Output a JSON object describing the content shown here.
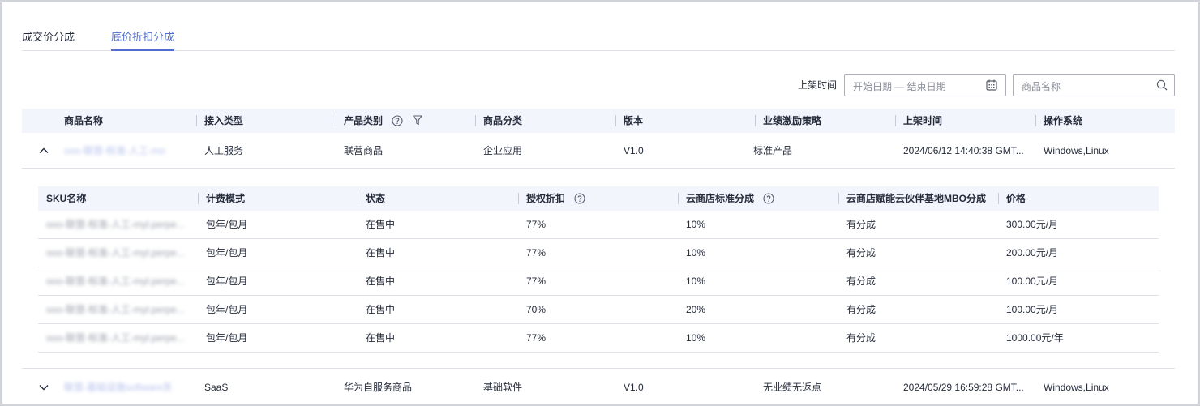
{
  "tabs": [
    {
      "label": "成交价分成",
      "active": false
    },
    {
      "label": "底价折扣分成",
      "active": true
    }
  ],
  "filters": {
    "listing_time_label": "上架时间",
    "date_placeholder": "开始日期 — 结束日期",
    "name_placeholder": "商品名称"
  },
  "main_table": {
    "headers": [
      "商品名称",
      "接入类型",
      "产品类别",
      "商品分类",
      "版本",
      "业绩激励策略",
      "上架时间",
      "操作系统"
    ],
    "rows": [
      {
        "name": "ooo-联营-标准-人工-mo",
        "access_type": "人工服务",
        "product_category": "联营商品",
        "classification": "企业应用",
        "version": "V1.0",
        "strategy": "标准产品",
        "listing_time": "2024/06/12 14:40:38 GMT...",
        "os": "Windows,Linux",
        "expanded": true
      },
      {
        "name": "联营-基础设施software测试",
        "access_type": "SaaS",
        "product_category": "华为自服务商品",
        "classification": "基础软件",
        "version": "V1.0",
        "strategy": "无业绩无返点",
        "listing_time": "2024/05/29 16:59:28 GMT...",
        "os": "Windows,Linux",
        "expanded": false
      }
    ]
  },
  "sku_table": {
    "headers": [
      "SKU名称",
      "计费模式",
      "状态",
      "授权折扣",
      "云商店标准分成",
      "云商店赋能云伙伴基地MBO分成",
      "价格"
    ],
    "rows": [
      {
        "name": "ooo-联营-标准-人工-myl.perpe...",
        "billing": "包年/包月",
        "status": "在售中",
        "discount": "77%",
        "standard_share": "10%",
        "mbo_share": "有分成",
        "price": "300.00元/月"
      },
      {
        "name": "ooo-联营-标准-人工-myl.perpe...",
        "billing": "包年/包月",
        "status": "在售中",
        "discount": "77%",
        "standard_share": "10%",
        "mbo_share": "有分成",
        "price": "200.00元/月"
      },
      {
        "name": "ooo-联营-标准-人工-myl.perpe...",
        "billing": "包年/包月",
        "status": "在售中",
        "discount": "77%",
        "standard_share": "10%",
        "mbo_share": "有分成",
        "price": "100.00元/月"
      },
      {
        "name": "ooo-联营-标准-人工-myl.perpe...",
        "billing": "包年/包月",
        "status": "在售中",
        "discount": "70%",
        "standard_share": "20%",
        "mbo_share": "有分成",
        "price": "100.00元/月"
      },
      {
        "name": "ooo-联营-标准-人工-myl.perpe...",
        "billing": "包年/包月",
        "status": "在售中",
        "discount": "77%",
        "standard_share": "10%",
        "mbo_share": "有分成",
        "price": "1000.00元/年"
      }
    ]
  },
  "colors": {
    "accent": "#526ecc",
    "header_bg": "#f2f5fc",
    "border": "#dfe1e6"
  },
  "icons": {
    "help": "question-circle-icon",
    "filter": "funnel-icon",
    "calendar": "calendar-icon",
    "search": "search-icon",
    "collapse": "chevron-up-icon",
    "expand": "chevron-down-icon"
  }
}
